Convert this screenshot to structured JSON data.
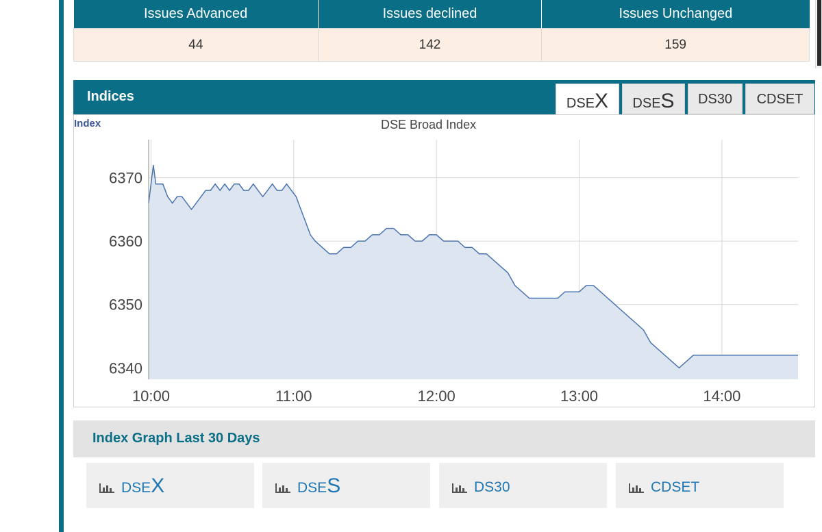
{
  "issues": {
    "headers": [
      "Issues Advanced",
      "Issues declined",
      "Issues Unchanged"
    ],
    "values": [
      "44",
      "142",
      "159"
    ]
  },
  "indices": {
    "title": "Indices",
    "tabs": [
      {
        "prefix": "DSE",
        "suffix": "X"
      },
      {
        "prefix": "DSE",
        "suffix": "S"
      },
      {
        "prefix": "DS30",
        "suffix": ""
      },
      {
        "prefix": "CDSET",
        "suffix": ""
      }
    ],
    "active_tab": 0
  },
  "colors": {
    "brand": "#0a6f86",
    "line": "#4a74b0",
    "fill": "#dde6f0"
  },
  "chart_data": {
    "type": "area",
    "title": "DSE Broad Index",
    "ylabel": "Index",
    "xlabel": "",
    "x_tick_labels": [
      "10:00",
      "11:00",
      "12:00",
      "13:00",
      "14:00"
    ],
    "y_tick_labels": [
      "6340",
      "6350",
      "6360",
      "6370"
    ],
    "xlim": [
      "09:59",
      "14:32"
    ],
    "ylim": [
      6338.2,
      6376
    ],
    "grid": true,
    "series": [
      {
        "x": [
          "09:59",
          "10:01",
          "10:02",
          "10:03",
          "10:05",
          "10:07",
          "10:09",
          "10:11",
          "10:13",
          "10:15",
          "10:17",
          "10:19",
          "10:21",
          "10:23",
          "10:25",
          "10:27",
          "10:29",
          "10:31",
          "10:33",
          "10:35",
          "10:37",
          "10:39",
          "10:41",
          "10:43",
          "10:45",
          "10:47",
          "10:49",
          "10:51",
          "10:53",
          "10:55",
          "10:57",
          "10:59",
          "11:01",
          "11:03",
          "11:05",
          "11:07",
          "11:09",
          "11:12",
          "11:15",
          "11:18",
          "11:21",
          "11:24",
          "11:27",
          "11:30",
          "11:33",
          "11:36",
          "11:39",
          "11:42",
          "11:45",
          "11:48",
          "11:51",
          "11:54",
          "11:57",
          "12:00",
          "12:03",
          "12:06",
          "12:09",
          "12:12",
          "12:15",
          "12:18",
          "12:21",
          "12:24",
          "12:27",
          "12:30",
          "12:33",
          "12:36",
          "12:39",
          "12:42",
          "12:45",
          "12:48",
          "12:51",
          "12:54",
          "12:57",
          "13:00",
          "13:03",
          "13:06",
          "13:09",
          "13:12",
          "13:15",
          "13:18",
          "13:21",
          "13:24",
          "13:27",
          "13:30",
          "13:33",
          "13:36",
          "13:39",
          "13:42",
          "13:45",
          "13:48",
          "13:51",
          "13:54",
          "13:57",
          "14:00",
          "14:03",
          "14:05",
          "14:07",
          "14:09",
          "14:11",
          "14:13",
          "14:15",
          "14:17",
          "14:20",
          "14:24",
          "14:28",
          "14:32"
        ],
        "values": [
          6366,
          6372,
          6369,
          6369,
          6369,
          6367,
          6366,
          6367,
          6367,
          6366,
          6365,
          6366,
          6367,
          6368,
          6368,
          6369,
          6368,
          6369,
          6368,
          6369,
          6369,
          6368,
          6368,
          6369,
          6368,
          6367,
          6368,
          6369,
          6368,
          6368,
          6369,
          6368,
          6367,
          6365,
          6363,
          6361,
          6360,
          6359,
          6358,
          6358,
          6359,
          6359,
          6360,
          6360,
          6361,
          6361,
          6362,
          6362,
          6361,
          6361,
          6360,
          6360,
          6361,
          6361,
          6360,
          6360,
          6360,
          6359,
          6359,
          6358,
          6358,
          6357,
          6356,
          6355,
          6353,
          6352,
          6351,
          6351,
          6351,
          6351,
          6351,
          6352,
          6352,
          6352,
          6353,
          6353,
          6352,
          6351,
          6350,
          6349,
          6348,
          6347,
          6346,
          6344,
          6343,
          6342,
          6341,
          6340,
          6341,
          6342,
          6342,
          6342,
          6342,
          6342,
          6342,
          6342,
          6342,
          6342,
          6342,
          6342,
          6342,
          6342,
          6342,
          6342,
          6342,
          6342
        ]
      }
    ]
  },
  "days30": {
    "title": "Index Graph Last 30 Days",
    "buttons": [
      {
        "prefix": "DSE",
        "suffix": "X"
      },
      {
        "prefix": "DSE",
        "suffix": "S"
      },
      {
        "prefix": "DS30",
        "suffix": ""
      },
      {
        "prefix": "CDSET",
        "suffix": ""
      }
    ]
  }
}
